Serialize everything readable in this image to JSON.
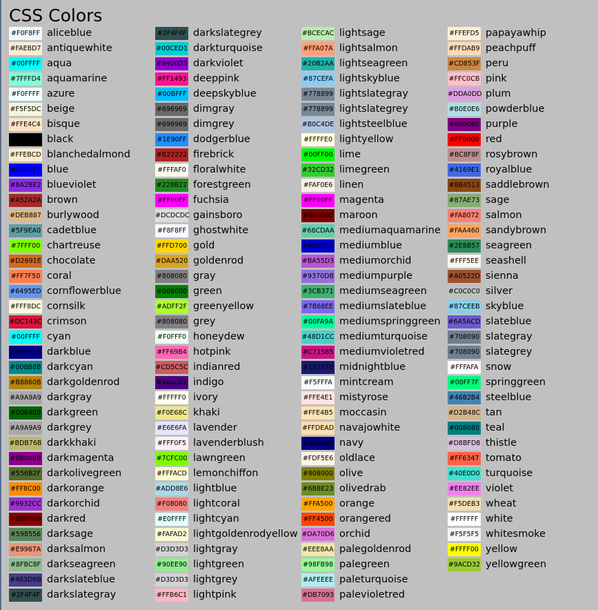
{
  "chart_data": {
    "type": "table",
    "title": "CSS Colors",
    "columns": [
      [
        {
          "name": "aliceblue",
          "hex": "#F0F8FF"
        },
        {
          "name": "antiquewhite",
          "hex": "#FAEBD7"
        },
        {
          "name": "aqua",
          "hex": "#00FFFF"
        },
        {
          "name": "aquamarine",
          "hex": "#7FFFD4"
        },
        {
          "name": "azure",
          "hex": "#F0FFFF"
        },
        {
          "name": "beige",
          "hex": "#F5F5DC"
        },
        {
          "name": "bisque",
          "hex": "#FFE4C4"
        },
        {
          "name": "black",
          "hex": "#000000"
        },
        {
          "name": "blanchedalmond",
          "hex": "#FFEBCD"
        },
        {
          "name": "blue",
          "hex": "#0000FF"
        },
        {
          "name": "blueviolet",
          "hex": "#8A2BE2"
        },
        {
          "name": "brown",
          "hex": "#A52A2A"
        },
        {
          "name": "burlywood",
          "hex": "#DEB887"
        },
        {
          "name": "cadetblue",
          "hex": "#5F9EA0"
        },
        {
          "name": "chartreuse",
          "hex": "#7FFF00"
        },
        {
          "name": "chocolate",
          "hex": "#D2691E"
        },
        {
          "name": "coral",
          "hex": "#FF7F50"
        },
        {
          "name": "cornflowerblue",
          "hex": "#6495ED"
        },
        {
          "name": "cornsilk",
          "hex": "#FFF8DC"
        },
        {
          "name": "crimson",
          "hex": "#DC143C"
        },
        {
          "name": "cyan",
          "hex": "#00FFFF"
        },
        {
          "name": "darkblue",
          "hex": "#00008B"
        },
        {
          "name": "darkcyan",
          "hex": "#008B8B"
        },
        {
          "name": "darkgoldenrod",
          "hex": "#B8860B"
        },
        {
          "name": "darkgray",
          "hex": "#A9A9A9"
        },
        {
          "name": "darkgreen",
          "hex": "#006400"
        },
        {
          "name": "darkgrey",
          "hex": "#A9A9A9"
        },
        {
          "name": "darkkhaki",
          "hex": "#BDB76B"
        },
        {
          "name": "darkmagenta",
          "hex": "#8B008B"
        },
        {
          "name": "darkolivegreen",
          "hex": "#556B2F"
        },
        {
          "name": "darkorange",
          "hex": "#FF8C00"
        },
        {
          "name": "darkorchid",
          "hex": "#9932CC"
        },
        {
          "name": "darkred",
          "hex": "#8B0000"
        },
        {
          "name": "darksage",
          "hex": "#598556"
        },
        {
          "name": "darksalmon",
          "hex": "#E9967A"
        },
        {
          "name": "darkseagreen",
          "hex": "#8FBC8F"
        },
        {
          "name": "darkslateblue",
          "hex": "#483D8B"
        },
        {
          "name": "darkslategray",
          "hex": "#2F4F4F"
        }
      ],
      [
        {
          "name": "darkslategrey",
          "hex": "#2F4F4F"
        },
        {
          "name": "darkturquoise",
          "hex": "#00CED1"
        },
        {
          "name": "darkviolet",
          "hex": "#9400D3"
        },
        {
          "name": "deeppink",
          "hex": "#FF1493"
        },
        {
          "name": "deepskyblue",
          "hex": "#00BFFF"
        },
        {
          "name": "dimgray",
          "hex": "#696969"
        },
        {
          "name": "dimgrey",
          "hex": "#696969"
        },
        {
          "name": "dodgerblue",
          "hex": "#1E90FF"
        },
        {
          "name": "firebrick",
          "hex": "#B22222"
        },
        {
          "name": "floralwhite",
          "hex": "#FFFAF0"
        },
        {
          "name": "forestgreen",
          "hex": "#228B22"
        },
        {
          "name": "fuchsia",
          "hex": "#FF00FF"
        },
        {
          "name": "gainsboro",
          "hex": "#DCDCDC"
        },
        {
          "name": "ghostwhite",
          "hex": "#F8F8FF"
        },
        {
          "name": "gold",
          "hex": "#FFD700"
        },
        {
          "name": "goldenrod",
          "hex": "#DAA520"
        },
        {
          "name": "gray",
          "hex": "#808080"
        },
        {
          "name": "green",
          "hex": "#008000"
        },
        {
          "name": "greenyellow",
          "hex": "#ADFF2F"
        },
        {
          "name": "grey",
          "hex": "#808080"
        },
        {
          "name": "honeydew",
          "hex": "#F0FFF0"
        },
        {
          "name": "hotpink",
          "hex": "#FF69B4"
        },
        {
          "name": "indianred",
          "hex": "#CD5C5C"
        },
        {
          "name": "indigo",
          "hex": "#4B0082"
        },
        {
          "name": "ivory",
          "hex": "#FFFFF0"
        },
        {
          "name": "khaki",
          "hex": "#F0E68C"
        },
        {
          "name": "lavender",
          "hex": "#E6E6FA"
        },
        {
          "name": "lavenderblush",
          "hex": "#FFF0F5"
        },
        {
          "name": "lawngreen",
          "hex": "#7CFC00"
        },
        {
          "name": "lemonchiffon",
          "hex": "#FFFACD"
        },
        {
          "name": "lightblue",
          "hex": "#ADD8E6"
        },
        {
          "name": "lightcoral",
          "hex": "#F08080"
        },
        {
          "name": "lightcyan",
          "hex": "#E0FFFF"
        },
        {
          "name": "lightgoldenrodyellow",
          "hex": "#FAFAD2"
        },
        {
          "name": "lightgray",
          "hex": "#D3D3D3"
        },
        {
          "name": "lightgreen",
          "hex": "#90EE90"
        },
        {
          "name": "lightgrey",
          "hex": "#D3D3D3"
        },
        {
          "name": "lightpink",
          "hex": "#FFB6C1"
        }
      ],
      [
        {
          "name": "lightsage",
          "hex": "#BCECAC"
        },
        {
          "name": "lightsalmon",
          "hex": "#FFA07A"
        },
        {
          "name": "lightseagreen",
          "hex": "#20B2AA"
        },
        {
          "name": "lightskyblue",
          "hex": "#87CEFA"
        },
        {
          "name": "lightslategray",
          "hex": "#778899"
        },
        {
          "name": "lightslategrey",
          "hex": "#778899"
        },
        {
          "name": "lightsteelblue",
          "hex": "#B0C4DE"
        },
        {
          "name": "lightyellow",
          "hex": "#FFFFE0"
        },
        {
          "name": "lime",
          "hex": "#00FF00"
        },
        {
          "name": "limegreen",
          "hex": "#32CD32"
        },
        {
          "name": "linen",
          "hex": "#FAF0E6"
        },
        {
          "name": "magenta",
          "hex": "#FF00FF"
        },
        {
          "name": "maroon",
          "hex": "#800000"
        },
        {
          "name": "mediumaquamarine",
          "hex": "#66CDAA"
        },
        {
          "name": "mediumblue",
          "hex": "#0000CD"
        },
        {
          "name": "mediumorchid",
          "hex": "#BA55D3"
        },
        {
          "name": "mediumpurple",
          "hex": "#9370DB"
        },
        {
          "name": "mediumseagreen",
          "hex": "#3CB371"
        },
        {
          "name": "mediumslateblue",
          "hex": "#7B68EE"
        },
        {
          "name": "mediumspringgreen",
          "hex": "#00FA9A"
        },
        {
          "name": "mediumturquoise",
          "hex": "#48D1CC"
        },
        {
          "name": "mediumvioletred",
          "hex": "#C71585"
        },
        {
          "name": "midnightblue",
          "hex": "#191970"
        },
        {
          "name": "mintcream",
          "hex": "#F5FFFA"
        },
        {
          "name": "mistyrose",
          "hex": "#FFE4E1"
        },
        {
          "name": "moccasin",
          "hex": "#FFE4B5"
        },
        {
          "name": "navajowhite",
          "hex": "#FFDEAD"
        },
        {
          "name": "navy",
          "hex": "#000080"
        },
        {
          "name": "oldlace",
          "hex": "#FDF5E6"
        },
        {
          "name": "olive",
          "hex": "#808000"
        },
        {
          "name": "olivedrab",
          "hex": "#6B8E23"
        },
        {
          "name": "orange",
          "hex": "#FFA500"
        },
        {
          "name": "orangered",
          "hex": "#FF4500"
        },
        {
          "name": "orchid",
          "hex": "#DA70D6"
        },
        {
          "name": "palegoldenrod",
          "hex": "#EEE8AA"
        },
        {
          "name": "palegreen",
          "hex": "#98FB98"
        },
        {
          "name": "paleturquoise",
          "hex": "#AFEEEE"
        },
        {
          "name": "palevioletred",
          "hex": "#DB7093"
        }
      ],
      [
        {
          "name": "papayawhip",
          "hex": "#FFEFD5"
        },
        {
          "name": "peachpuff",
          "hex": "#FFDAB9"
        },
        {
          "name": "peru",
          "hex": "#CD853F"
        },
        {
          "name": "pink",
          "hex": "#FFC0CB"
        },
        {
          "name": "plum",
          "hex": "#DDA0DD"
        },
        {
          "name": "powderblue",
          "hex": "#B0E0E6"
        },
        {
          "name": "purple",
          "hex": "#800080"
        },
        {
          "name": "red",
          "hex": "#FF0000"
        },
        {
          "name": "rosybrown",
          "hex": "#BC8F8F"
        },
        {
          "name": "royalblue",
          "hex": "#4169E1"
        },
        {
          "name": "saddlebrown",
          "hex": "#8B4513"
        },
        {
          "name": "sage",
          "hex": "#87AE73"
        },
        {
          "name": "salmon",
          "hex": "#FA8072"
        },
        {
          "name": "sandybrown",
          "hex": "#FAA460"
        },
        {
          "name": "seagreen",
          "hex": "#2E8B57"
        },
        {
          "name": "seashell",
          "hex": "#FFF5EE"
        },
        {
          "name": "sienna",
          "hex": "#A0522D"
        },
        {
          "name": "silver",
          "hex": "#C0C0C0"
        },
        {
          "name": "skyblue",
          "hex": "#87CEEB"
        },
        {
          "name": "slateblue",
          "hex": "#6A5ACD"
        },
        {
          "name": "slategray",
          "hex": "#708090"
        },
        {
          "name": "slategrey",
          "hex": "#708090"
        },
        {
          "name": "snow",
          "hex": "#FFFAFA"
        },
        {
          "name": "springgreen",
          "hex": "#00FF7F"
        },
        {
          "name": "steelblue",
          "hex": "#4682B4"
        },
        {
          "name": "tan",
          "hex": "#D2B48C"
        },
        {
          "name": "teal",
          "hex": "#008080"
        },
        {
          "name": "thistle",
          "hex": "#D8BFD8"
        },
        {
          "name": "tomato",
          "hex": "#FF6347"
        },
        {
          "name": "turquoise",
          "hex": "#40E0D0"
        },
        {
          "name": "violet",
          "hex": "#EE82EE"
        },
        {
          "name": "wheat",
          "hex": "#F5DEB3"
        },
        {
          "name": "white",
          "hex": "#FFFFFF"
        },
        {
          "name": "whitesmoke",
          "hex": "#F5F5F5"
        },
        {
          "name": "yellow",
          "hex": "#FFFF00"
        },
        {
          "name": "yellowgreen",
          "hex": "#9ACD32"
        }
      ]
    ]
  }
}
